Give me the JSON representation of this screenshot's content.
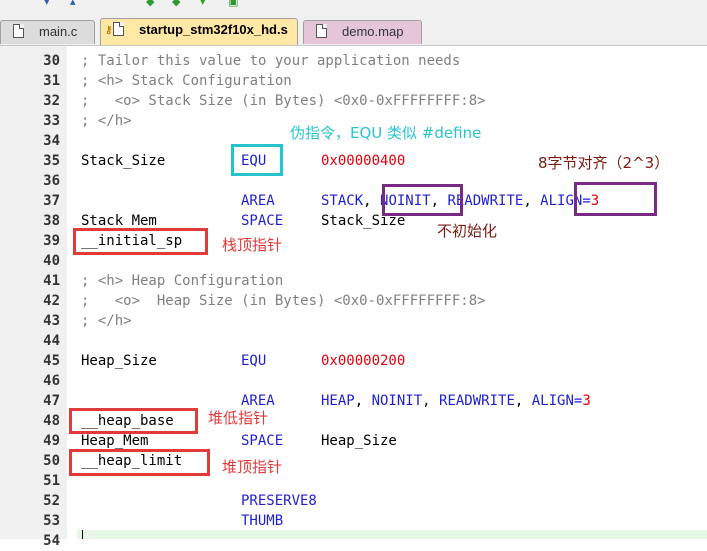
{
  "tabs": [
    {
      "label": "main.c"
    },
    {
      "label": "startup_stm32f10x_hd.s"
    },
    {
      "label": "demo.map"
    }
  ],
  "lines": [
    {
      "no": "30",
      "label": "",
      "op": "",
      "arg": "",
      "comment": "; Tailor this value to your application needs"
    },
    {
      "no": "31",
      "label": "",
      "op": "",
      "arg": "",
      "comment": "; <h> Stack Configuration"
    },
    {
      "no": "32",
      "label": "",
      "op": "",
      "arg": "",
      "comment": ";   <o> Stack Size (in Bytes) <0x0-0xFFFFFFFF:8>"
    },
    {
      "no": "33",
      "label": "",
      "op": "",
      "arg": "",
      "comment": "; </h>"
    },
    {
      "no": "34",
      "label": "",
      "op": "",
      "arg": "",
      "comment": ""
    },
    {
      "no": "35",
      "label": "Stack_Size",
      "op": "EQU",
      "arg": "0x00000400",
      "comment": ""
    },
    {
      "no": "36",
      "label": "",
      "op": "",
      "arg": "",
      "comment": ""
    },
    {
      "no": "37",
      "label": "",
      "op": "AREA",
      "arg": "STACK, NOINIT, READWRITE, ALIGN=3",
      "comment": ""
    },
    {
      "no": "38",
      "label": "Stack_Mem",
      "op": "SPACE",
      "arg": "Stack_Size",
      "comment": ""
    },
    {
      "no": "39",
      "label": "__initial_sp",
      "op": "",
      "arg": "",
      "comment": ""
    },
    {
      "no": "40",
      "label": "",
      "op": "",
      "arg": "",
      "comment": ""
    },
    {
      "no": "41",
      "label": "",
      "op": "",
      "arg": "",
      "comment": "; <h> Heap Configuration"
    },
    {
      "no": "42",
      "label": "",
      "op": "",
      "arg": "",
      "comment": ";   <o>  Heap Size (in Bytes) <0x0-0xFFFFFFFF:8>"
    },
    {
      "no": "43",
      "label": "",
      "op": "",
      "arg": "",
      "comment": "; </h>"
    },
    {
      "no": "44",
      "label": "",
      "op": "",
      "arg": "",
      "comment": ""
    },
    {
      "no": "45",
      "label": "Heap_Size",
      "op": "EQU",
      "arg": "0x00000200",
      "comment": ""
    },
    {
      "no": "46",
      "label": "",
      "op": "",
      "arg": "",
      "comment": ""
    },
    {
      "no": "47",
      "label": "",
      "op": "AREA",
      "arg": "HEAP, NOINIT, READWRITE, ALIGN=3",
      "comment": ""
    },
    {
      "no": "48",
      "label": "__heap_base",
      "op": "",
      "arg": "",
      "comment": ""
    },
    {
      "no": "49",
      "label": "Heap_Mem",
      "op": "SPACE",
      "arg": "Heap_Size",
      "comment": ""
    },
    {
      "no": "50",
      "label": "__heap_limit",
      "op": "",
      "arg": "",
      "comment": ""
    },
    {
      "no": "51",
      "label": "",
      "op": "",
      "arg": "",
      "comment": ""
    },
    {
      "no": "52",
      "label": "",
      "op": "PRESERVE8",
      "arg": "",
      "comment": ""
    },
    {
      "no": "53",
      "label": "",
      "op": "THUMB",
      "arg": "",
      "comment": ""
    },
    {
      "no": "54",
      "label": "",
      "op": "",
      "arg": "",
      "comment": ""
    }
  ],
  "annotations": {
    "equ_note": "伪指令，EQU 类似 #define",
    "align_note": "8字节对齐（2^3）",
    "noinit_note": "不初始化",
    "initial_sp_note": "栈顶指针",
    "heap_base_note": "堆低指针",
    "heap_limit_note": "堆顶指针"
  },
  "colors": {
    "teal": "#27c4cf",
    "purple": "#7a2a85",
    "red": "#e23a3a",
    "keyword": "#1f1fd2",
    "number": "#e0000e",
    "comment": "#808080"
  }
}
